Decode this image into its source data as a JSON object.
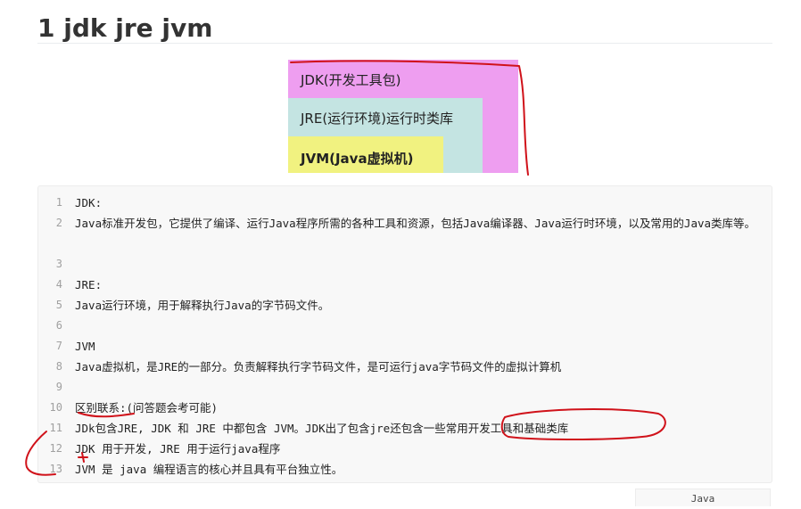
{
  "heading": "1 jdk jre jvm",
  "diagram": {
    "jdk_label": "JDK(开发工具包)",
    "jre_label": "JRE(运行环境)运行时类库",
    "jvm_label": "JVM(Java虚拟机)",
    "colors": {
      "jdk": "#ee9ef0",
      "jre": "#c4e4e2",
      "jvm": "#f1f280"
    }
  },
  "code": {
    "language": "Java",
    "lines": [
      {
        "num": "1",
        "text": "JDK:"
      },
      {
        "num": "2",
        "text": "Java标准开发包，它提供了编译、运行Java程序所需的各种工具和资源，包括Java编译器、Java运行时环境，以及常用的Java类库等。"
      },
      {
        "num": "3",
        "text": ""
      },
      {
        "num": "4",
        "text": "JRE:"
      },
      {
        "num": "5",
        "text": "Java运行环境，用于解释执行Java的字节码文件。"
      },
      {
        "num": "6",
        "text": ""
      },
      {
        "num": "7",
        "text": "JVM"
      },
      {
        "num": "8",
        "text": "Java虚拟机，是JRE的一部分。负责解释执行字节码文件，是可运行java字节码文件的虚拟计算机"
      },
      {
        "num": "9",
        "text": ""
      },
      {
        "num": "10",
        "text": "区别联系:(问答题会考可能)"
      },
      {
        "num": "11",
        "text": "JDk包含JRE, JDK 和 JRE 中都包含 JVM。JDK出了包含jre还包含一些常用开发工具和基础类库"
      },
      {
        "num": "12",
        "text": "JDK 用于开发, JRE 用于运行java程序"
      },
      {
        "num": "13",
        "text": "JVM 是 java 编程语言的核心并且具有平台独立性。"
      }
    ]
  },
  "annotation_color": "#d0121a"
}
